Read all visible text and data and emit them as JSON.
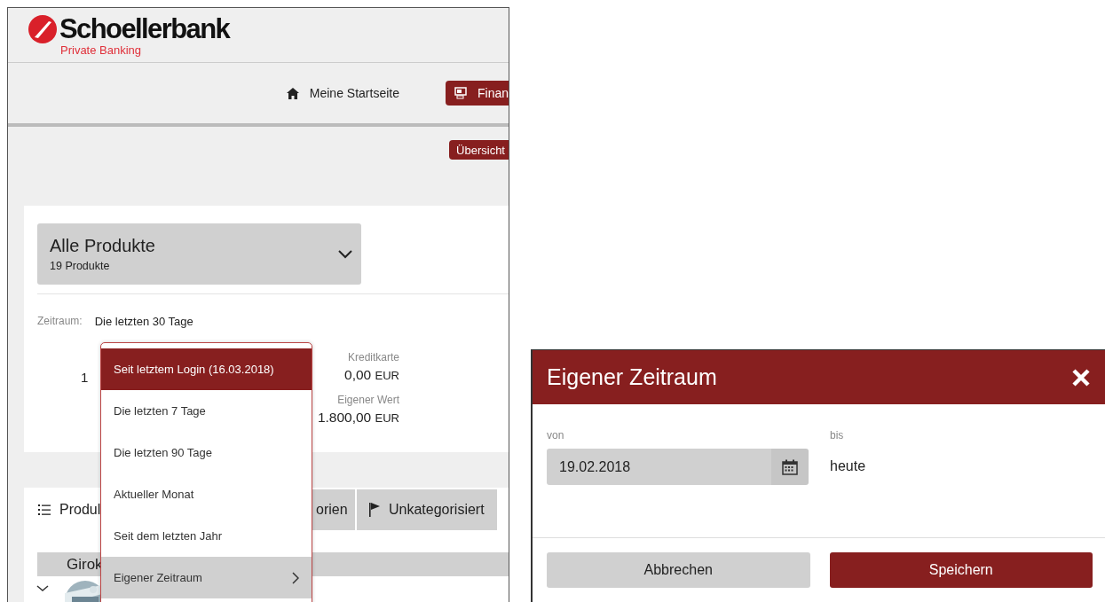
{
  "logo": {
    "name": "Schoellerbank",
    "tagline": "Private Banking"
  },
  "nav": [
    {
      "label": "Meine Startseite",
      "kind": "home",
      "selected": false
    },
    {
      "label": "Finan",
      "kind": "finance",
      "selected": true
    }
  ],
  "subnav": [
    {
      "label": "Übersicht",
      "selected": true
    }
  ],
  "product_select": {
    "title": "Alle Produkte",
    "count": "19 Produkte"
  },
  "period": {
    "label": "Zeitraum:",
    "value": "Die letzten 30 Tage"
  },
  "summary": {
    "left_value": "1",
    "items": [
      {
        "label": "Kreditkarte",
        "amount": "0,00",
        "currency": "EUR"
      },
      {
        "label": "Eigener Wert",
        "amount": "1.800,00",
        "currency": "EUR"
      }
    ]
  },
  "tabs": [
    {
      "label": "Produl",
      "kind": "list",
      "selected": true
    },
    {
      "label": "orien",
      "kind": "plain",
      "selected": false
    },
    {
      "label": "Unkategorisiert",
      "kind": "flag",
      "selected": false
    }
  ],
  "group_header": "Girok",
  "period_menu": {
    "items": [
      {
        "label": "Seit letztem Login (16.03.2018)",
        "selected": true,
        "highlighted": false,
        "submenu": false
      },
      {
        "label": "Die letzten 7 Tage",
        "selected": false,
        "highlighted": false,
        "submenu": false
      },
      {
        "label": "Die letzten 90 Tage",
        "selected": false,
        "highlighted": false,
        "submenu": false
      },
      {
        "label": "Aktueller Monat",
        "selected": false,
        "highlighted": false,
        "submenu": false
      },
      {
        "label": "Seit dem letzten Jahr",
        "selected": false,
        "highlighted": false,
        "submenu": false
      },
      {
        "label": "Eigener Zeitraum",
        "selected": false,
        "highlighted": true,
        "submenu": true
      }
    ]
  },
  "dialog": {
    "title": "Eigener Zeitraum",
    "from": {
      "label": "von",
      "value": "19.02.2018"
    },
    "to": {
      "label": "bis",
      "value": "heute"
    },
    "buttons": [
      {
        "label": "Abbrechen",
        "kind": "secondary"
      },
      {
        "label": "Speichern",
        "kind": "primary"
      }
    ]
  }
}
